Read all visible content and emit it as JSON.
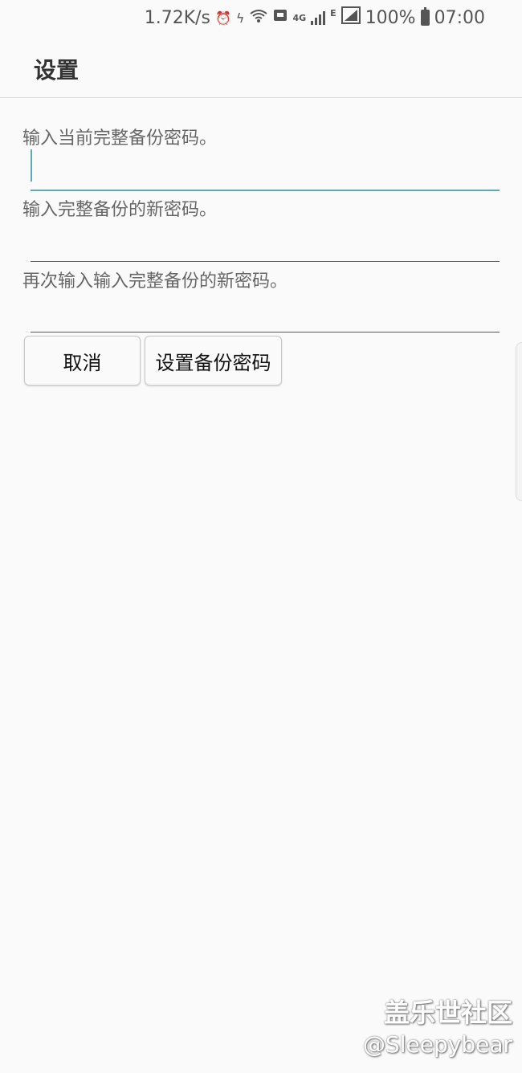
{
  "status_bar": {
    "net_speed": "1.72K/s",
    "network_4g": "4G",
    "network_e": "E",
    "battery": "100%",
    "time": "07:00",
    "icons": [
      "alarm-icon",
      "flash-icon",
      "wifi-icon",
      "message-icon",
      "signal-icon",
      "signal-icon",
      "battery-icon"
    ]
  },
  "header": {
    "title": "设置"
  },
  "form": {
    "current_password_label": "输入当前完整备份密码。",
    "new_password_label": "输入完整备份的新密码。",
    "confirm_password_label": "再次输入输入完整备份的新密码。",
    "current_password_value": "",
    "new_password_value": "",
    "confirm_password_value": ""
  },
  "buttons": {
    "cancel": "取消",
    "set_password": "设置备份密码"
  },
  "watermark": {
    "site": "盖乐世社区",
    "user": "@Sleepybear"
  },
  "colors": {
    "accent": "#5fa8b8",
    "background": "#fafafa"
  }
}
